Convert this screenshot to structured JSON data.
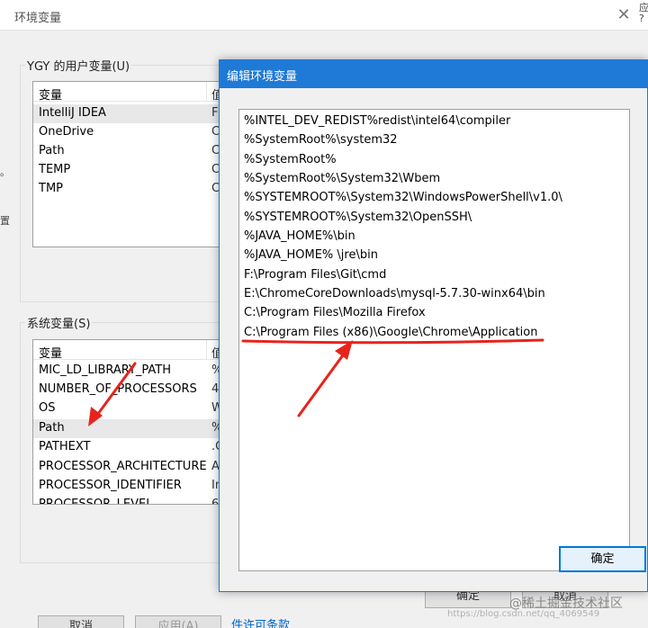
{
  "env_window": {
    "title": "环境变量",
    "close_icon": "close-icon",
    "edge_text_right_1": "应",
    "edge_text_right_2": "?",
    "user_vars": {
      "label": "YGY 的用户变量(U)",
      "col_name": "变量",
      "col_value": "值",
      "rows": [
        {
          "name": "IntelliJ IDEA",
          "value": "F"
        },
        {
          "name": "OneDrive",
          "value": "C"
        },
        {
          "name": "Path",
          "value": "C"
        },
        {
          "name": "TEMP",
          "value": "C"
        },
        {
          "name": "TMP",
          "value": "C"
        }
      ]
    },
    "system_vars": {
      "label": "系统变量(S)",
      "col_name": "变量",
      "col_value": "值",
      "rows": [
        {
          "name": "MIC_LD_LIBRARY_PATH",
          "value": "%"
        },
        {
          "name": "NUMBER_OF_PROCESSORS",
          "value": "4"
        },
        {
          "name": "OS",
          "value": "W"
        },
        {
          "name": "Path",
          "value": "%"
        },
        {
          "name": "PATHEXT",
          "value": ".C"
        },
        {
          "name": "PROCESSOR_ARCHITECTURE",
          "value": "A"
        },
        {
          "name": "PROCESSOR_IDENTIFIER",
          "value": "In"
        },
        {
          "name": "PROCESSOR_LEVEL",
          "value": "6"
        }
      ]
    },
    "buttons": {
      "ok": "确定",
      "cancel": "取消",
      "bottom_cancel": "取消",
      "bottom_apply": "应用(A)"
    },
    "link_fragment": "件许可条款",
    "left_fragments": [
      "。",
      "置"
    ]
  },
  "edit_dialog": {
    "title": "编辑环境变量",
    "paths": [
      "%INTEL_DEV_REDIST%redist\\intel64\\compiler",
      "%SystemRoot%\\system32",
      "%SystemRoot%",
      "%SystemRoot%\\System32\\Wbem",
      "%SYSTEMROOT%\\System32\\WindowsPowerShell\\v1.0\\",
      "%SYSTEMROOT%\\System32\\OpenSSH\\",
      "%JAVA_HOME%\\bin",
      "%JAVA_HOME% \\jre\\bin",
      "F:\\Program Files\\Git\\cmd",
      "E:\\ChromeCoreDownloads\\mysql-5.7.30-winx64\\bin",
      "C:\\Program Files\\Mozilla Firefox",
      "C:\\Program Files (x86)\\Google\\Chrome\\Application"
    ],
    "ok_label": "确定"
  },
  "annotations": {
    "arrow_color": "#e8231c",
    "watermark": "@稀土掘金技术社区",
    "watermark_url": "https://blog.csdn.net/qq_4069549"
  },
  "colors": {
    "title_bar_blue": "#1e7ad6",
    "ok_border": "#0078d7",
    "window_bg": "#f0f0f0"
  }
}
